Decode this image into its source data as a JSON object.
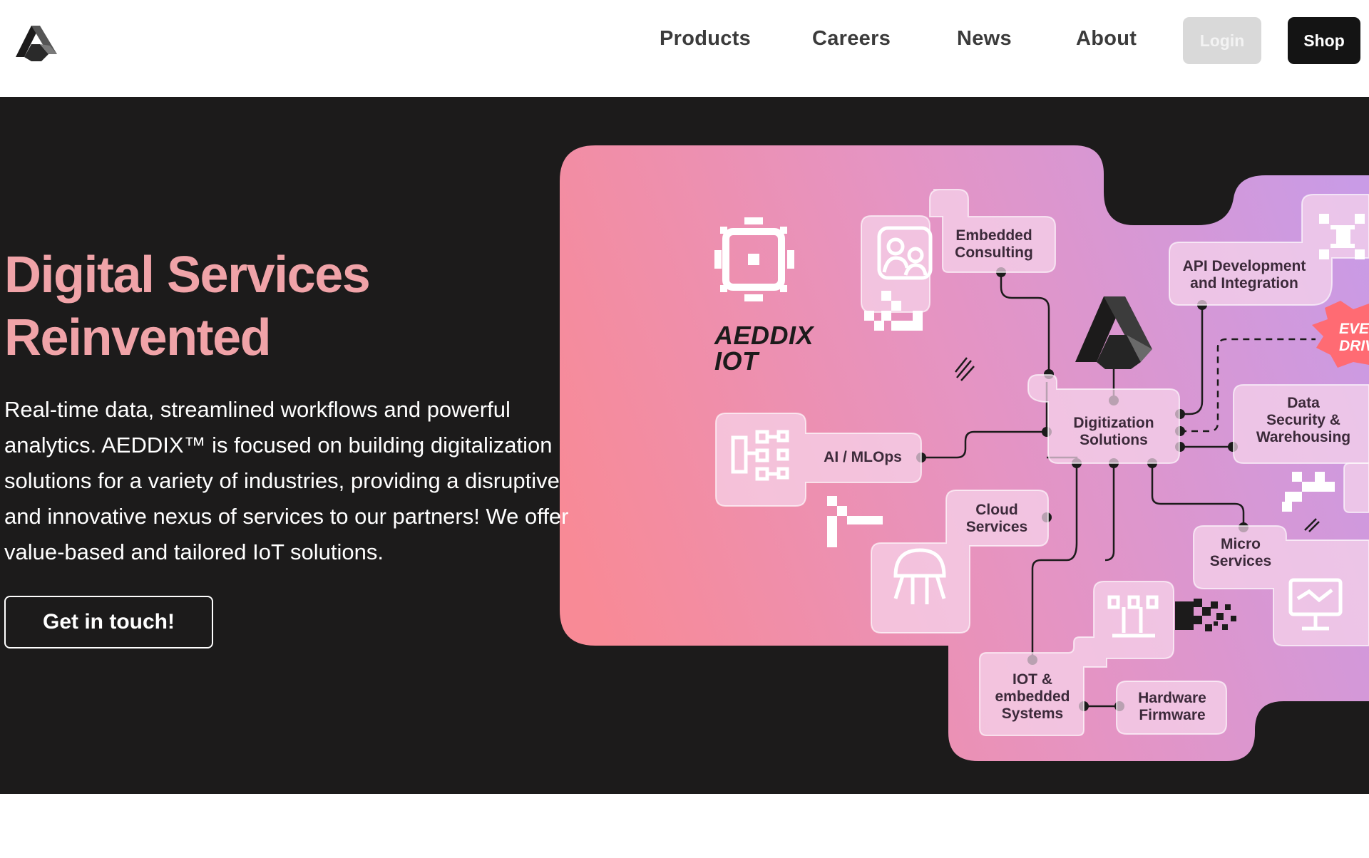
{
  "header": {
    "logo_icon": "aeddix-logo-icon",
    "nav": [
      {
        "label": "Products"
      },
      {
        "label": "Careers"
      },
      {
        "label": "News"
      },
      {
        "label": "About"
      }
    ],
    "login_label": "Login",
    "shop_label": "Shop"
  },
  "hero": {
    "title_line1": "Digital Services",
    "title_line2": "Reinvented",
    "description_lines": [
      "Real-time data, streamlined workflows and powerful",
      "analytics. AEDDIX™ is focused on building digitalization",
      "solutions for a variety of industries, providing a disruptive",
      "and innovative nexus of services to our partners! We offer",
      "value-based and tailored IoT solutions."
    ],
    "cta_label": "Get in touch!"
  },
  "illustration": {
    "brand_line1": "AEDDIX",
    "brand_line2": "IOT",
    "badge_line1": "EVE",
    "badge_line2": "DRIV",
    "nodes": {
      "embedded_consulting": [
        "Embedded",
        "Consulting"
      ],
      "api_development": [
        "API Development",
        "and Integration"
      ],
      "digitization": [
        "Digitization",
        "Solutions"
      ],
      "ai_mlops": [
        "AI / MLOps"
      ],
      "data_security": [
        "Data",
        "Security &",
        "Warehousing"
      ],
      "cloud_services": [
        "Cloud",
        "Services"
      ],
      "micro_services": [
        "Micro",
        "Services"
      ],
      "iot_embedded": [
        "IOT &",
        "embedded",
        "Systems"
      ],
      "hardware_firmware": [
        "Hardware",
        "Firmware"
      ]
    },
    "colors": {
      "gradient_start": "#f88a96",
      "gradient_end": "#c99be6",
      "card_fill": "#f6d6ec",
      "line": "#1c1b1b"
    }
  }
}
